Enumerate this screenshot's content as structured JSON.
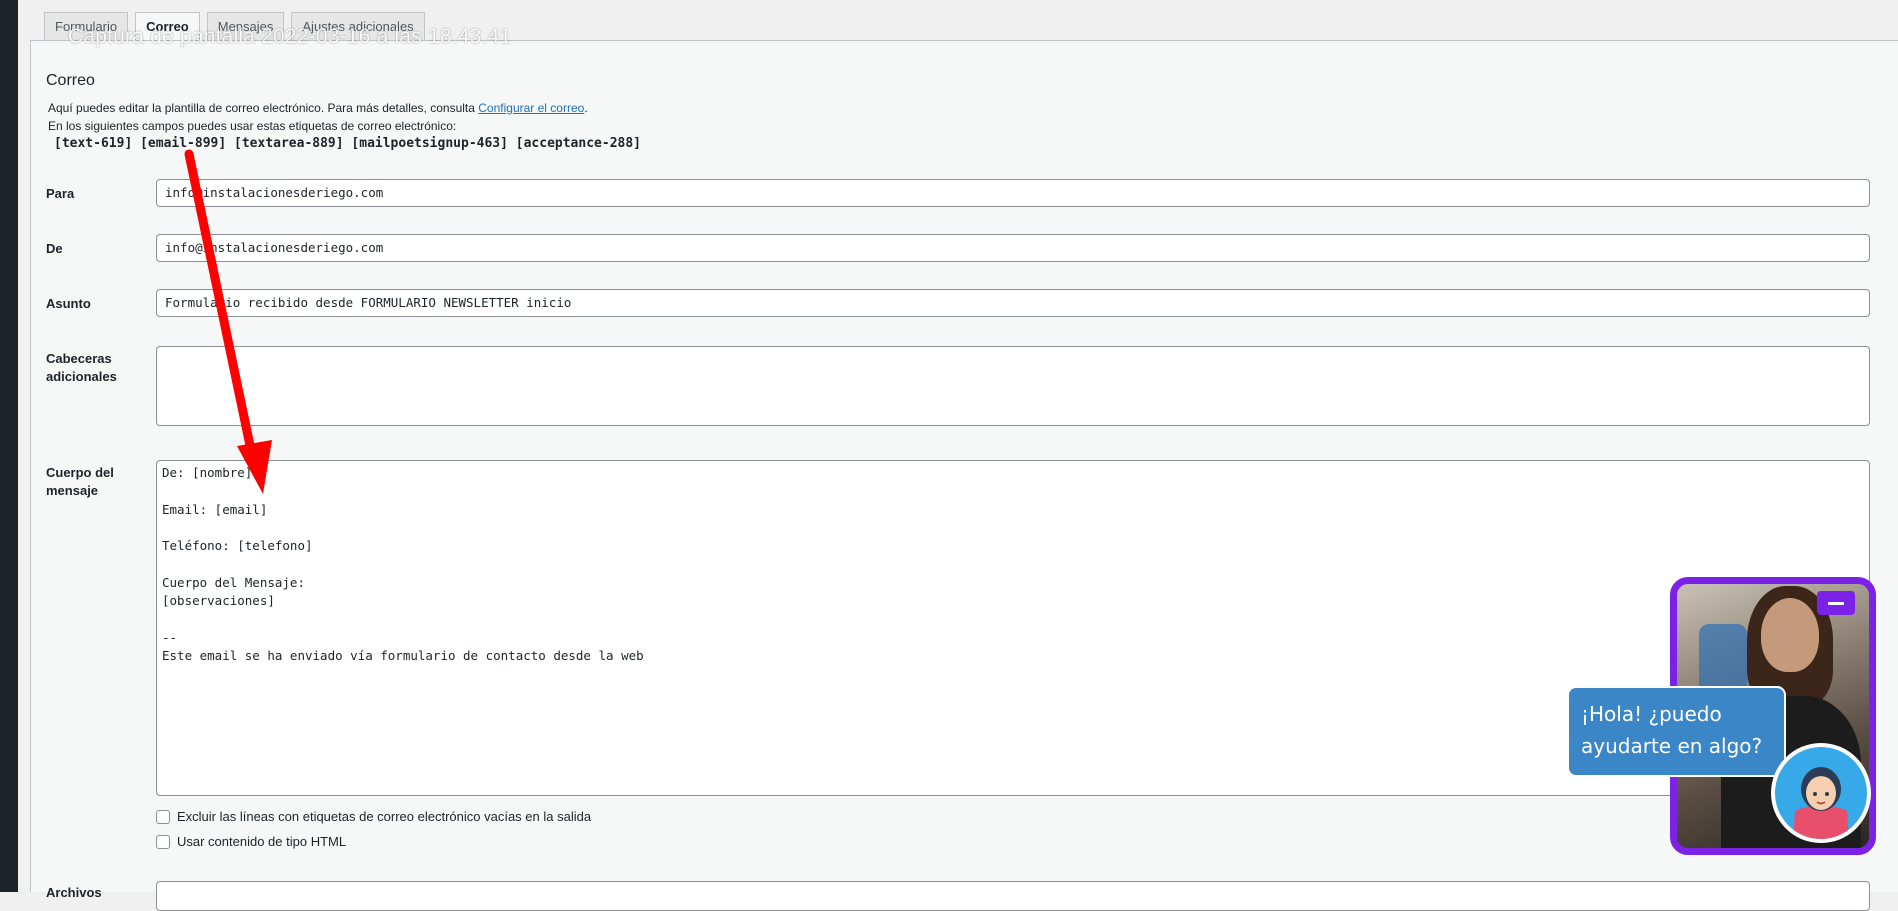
{
  "tabs": [
    "Formulario",
    "Correo",
    "Mensajes",
    "Ajustes adicionales"
  ],
  "overlay_title": "Captura de pantalla 2022-03-16 a las 18.43.41",
  "section_title": "Correo",
  "description": {
    "line1_prefix": "Aquí puedes editar la plantilla de correo electrónico. Para más detalles, consulta ",
    "line1_link": "Configurar el correo",
    "line1_suffix": ".",
    "line2": "En los siguientes campos puedes usar estas etiquetas de correo electrónico:",
    "mail_tags": "[text-619] [email-899] [textarea-889] [mailpoetsignup-463] [acceptance-288]"
  },
  "fields": {
    "para": {
      "label": "Para",
      "value": "info@instalacionesderiego.com"
    },
    "de": {
      "label": "De",
      "value": "info@instalacionesderiego.com"
    },
    "asunto": {
      "label": "Asunto",
      "value": "Formulario recibido desde FORMULARIO NEWSLETTER inicio"
    },
    "cabeceras": {
      "label_line1": "Cabeceras",
      "label_line2": "adicionales",
      "value": ""
    },
    "cuerpo": {
      "label_line1": "Cuerpo del",
      "label_line2": "mensaje",
      "lines": [
        "De: [nombre]",
        "",
        "Email: [email]",
        "",
        "Teléfono: [telefono]",
        "",
        "Cuerpo del Mensaje:",
        "[observaciones]",
        "",
        "--",
        "Este email se ha enviado vía formulario de contacto desde la web"
      ]
    }
  },
  "checkboxes": [
    {
      "label": "Excluir las líneas con etiquetas de correo electrónico vacías en la salida",
      "checked": false
    },
    {
      "label": "Usar contenido de tipo HTML",
      "checked": false
    }
  ],
  "archivos_label": "Archivos",
  "chat_widget": {
    "bubble_text": "¡Hola! ¿puedo ayudarte en algo?",
    "accent_color": "#7b22e6",
    "bubble_color": "#3a86c6"
  },
  "annotation_arrow_color": "#ff0000"
}
